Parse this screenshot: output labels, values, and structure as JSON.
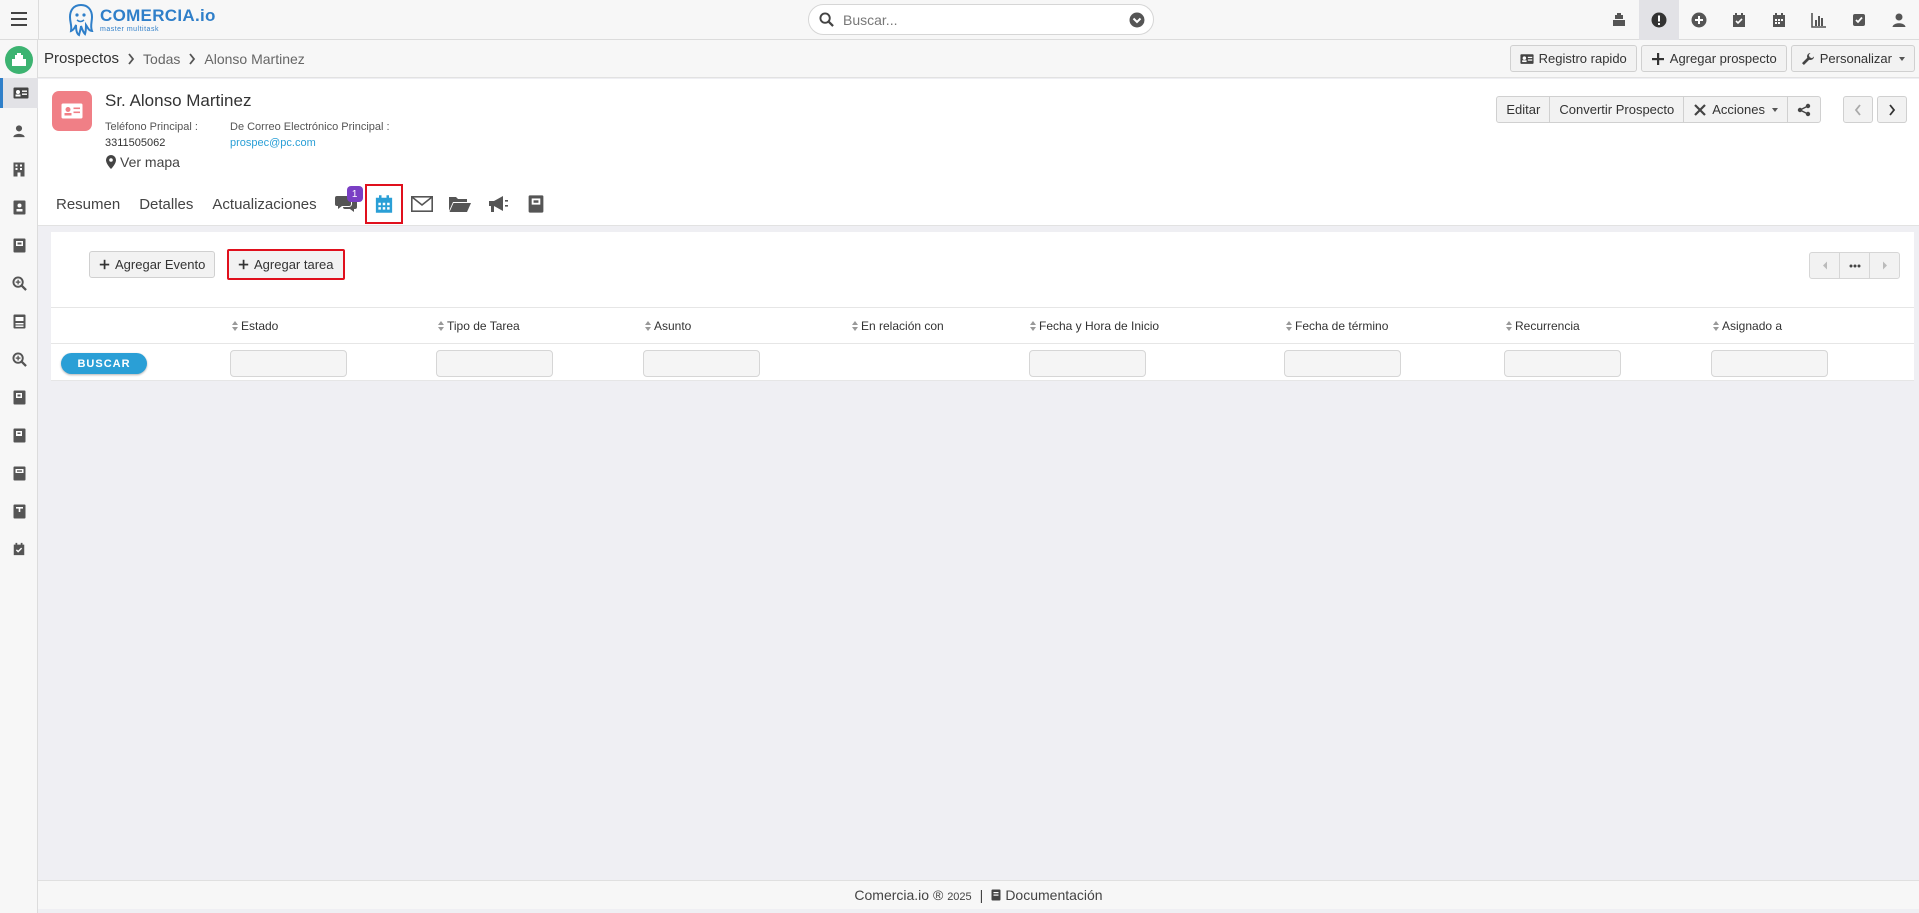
{
  "app": {
    "logo_title": "COMERCIA.io",
    "logo_subtitle": "master multitask"
  },
  "search": {
    "placeholder": "Buscar..."
  },
  "top_icons": [
    "cash-register-icon",
    "alert-icon",
    "plus-circle-icon",
    "calendar-check-icon",
    "calendar-icon",
    "bar-chart-icon",
    "checkbox-icon",
    "user-icon"
  ],
  "breadcrumb": {
    "module": "Prospectos",
    "list": "Todas",
    "record": "Alonso Martinez"
  },
  "header_actions": {
    "quick_register": "Registro rapido",
    "add_prospect": "Agregar prospecto",
    "customize": "Personalizar"
  },
  "record": {
    "name": "Sr. Alonso Martinez",
    "phone_label": "Teléfono Principal :",
    "phone_value": "3311505062",
    "email_label": "De Correo Electrónico Principal :",
    "email_value": "prospec@pc.com",
    "map_link": "Ver mapa"
  },
  "record_actions": {
    "edit": "Editar",
    "convert": "Convertir Prospecto",
    "actions": "Acciones"
  },
  "tabs": {
    "summary": "Resumen",
    "details": "Detalles",
    "updates": "Actualizaciones",
    "comments_badge": "1"
  },
  "panel": {
    "add_event": "Agregar Evento",
    "add_task": "Agregar tarea",
    "search_button": "BUSCAR"
  },
  "table": {
    "columns": [
      "Estado",
      "Tipo de Tarea",
      "Asunto",
      "En relación con",
      "Fecha y Hora de Inicio",
      "Fecha de término",
      "Recurrencia",
      "Asignado a"
    ]
  },
  "footer": {
    "brand": "Comercia.io ®",
    "year": "2025",
    "separator": "|",
    "docs": "Documentación"
  },
  "colors": {
    "accent": "#2a9fd6",
    "highlight": "#e0101d",
    "badge": "#7a3fc4",
    "avatar": "#f07f86",
    "home": "#3cb371"
  }
}
